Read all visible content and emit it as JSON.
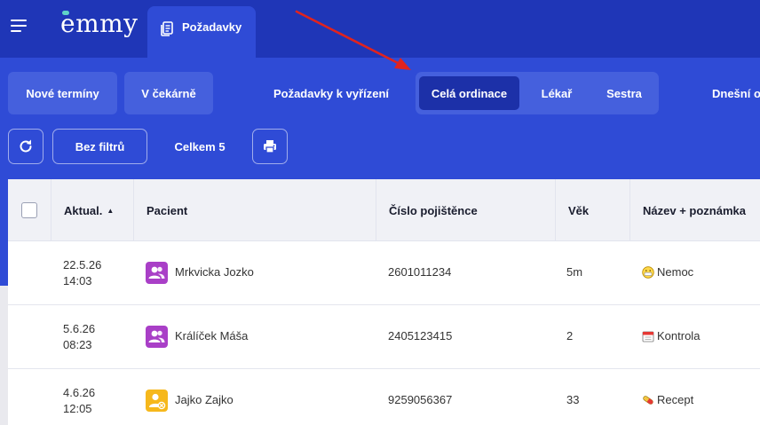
{
  "app": {
    "logo": "emmy",
    "active_tab": "Požadavky"
  },
  "filters": {
    "new_terms": "Nové termíny",
    "waiting_room": "V čekárně",
    "pending_requests": "Požadavky k vyřízení",
    "segments": [
      "Celá ordinace",
      "Lékař",
      "Sestra"
    ],
    "active_segment": "Celá ordinace",
    "today": "Dnešní o"
  },
  "toolbar": {
    "no_filters": "Bez filtrů",
    "total": "Celkem 5"
  },
  "table": {
    "columns": [
      "Aktual.",
      "Pacient",
      "Číslo pojištěnce",
      "Věk",
      "Název + poznámka"
    ],
    "sort_indicator": "▲",
    "rows": [
      {
        "date": "22.5.26",
        "time": "14:03",
        "patient": "Mrkvicka Jozko",
        "insurance": "2601011234",
        "age": "5m",
        "note": "Nemoc",
        "note_icon": "sick-face-icon",
        "avatar_color": "#a93fc7",
        "avatar_icon": "users-icon"
      },
      {
        "date": "5.6.26",
        "time": "08:23",
        "patient": "Králíček Máša",
        "insurance": "2405123415",
        "age": "2",
        "note": "Kontrola",
        "note_icon": "calendar-icon",
        "avatar_color": "#a93fc7",
        "avatar_icon": "users-icon"
      },
      {
        "date": "4.6.26",
        "time": "12:05",
        "patient": "Jajko Zajko",
        "insurance": "9259056367",
        "age": "33",
        "note": "Recept",
        "note_icon": "pill-icon",
        "avatar_color": "#f6b81c",
        "avatar_icon": "user-blocked-icon"
      }
    ]
  },
  "colors": {
    "topbar": "#1f36b7",
    "page": "#2f4bd6",
    "accent_active": "#1c30a8",
    "arrow": "#e0231f"
  }
}
